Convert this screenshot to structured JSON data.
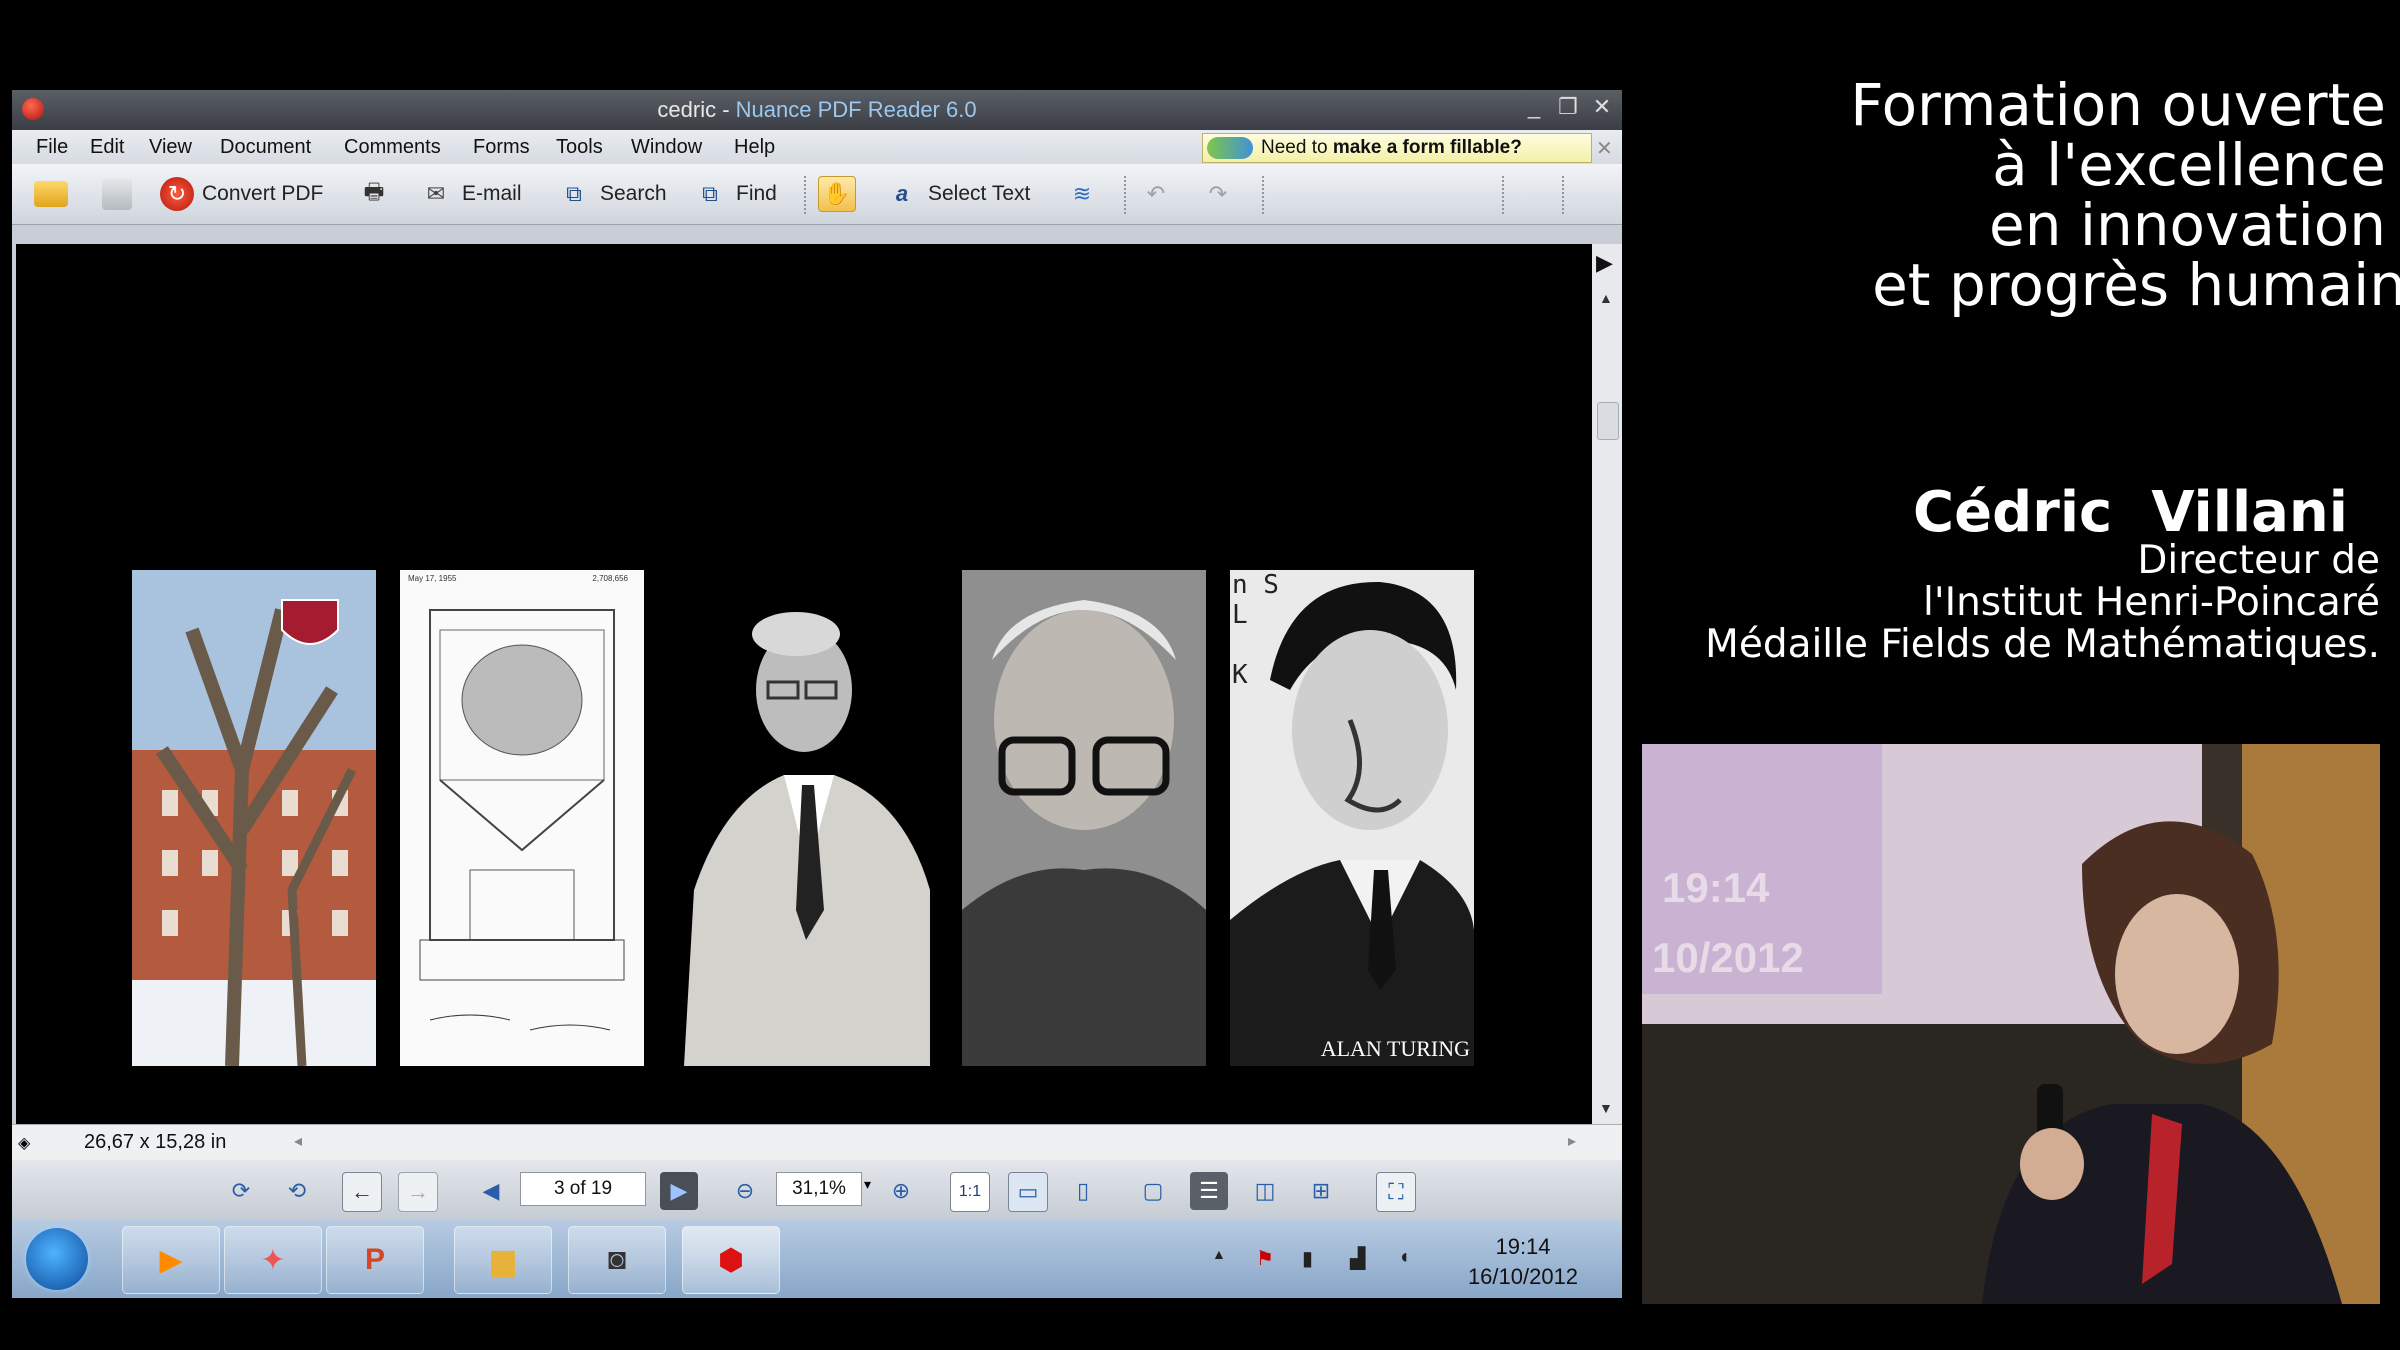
{
  "window": {
    "title_doc": "cedric",
    "title_sep": " - ",
    "title_app": "Nuance PDF Reader 6.0",
    "controls": [
      "_",
      "❐",
      "✕"
    ]
  },
  "menu": [
    "File",
    "Edit",
    "View",
    "Document",
    "Comments",
    "Forms",
    "Tools",
    "Window",
    "Help"
  ],
  "promo": {
    "prefix": "Need to ",
    "bold": "make a form fillable?",
    "close": "✕"
  },
  "toolbar": {
    "convert_label": "Convert PDF",
    "email_label": "E-mail",
    "search_label": "Search",
    "find_label": "Find",
    "select_text_label": "Select Text"
  },
  "document": {
    "turing_caption": "ALAN TURING",
    "patent_header": "May 17, 1955",
    "patent_number": "2,708,656",
    "stencil_letters": "n S\nL\n\nK"
  },
  "statusbar": {
    "page_size": "26,67 x 15,28 in"
  },
  "navbar": {
    "page_indicator": "3 of 19",
    "zoom": "31,1%",
    "actual_size": "1:1"
  },
  "taskbar": {
    "time": "19:14",
    "date": "16/10/2012"
  },
  "overlay": {
    "heading_lines": [
      "Formation ouverte",
      "à l'excellence",
      "en innovation",
      "et progrès humain"
    ],
    "speaker_name": "Cédric  Villani",
    "speaker_role_lines": [
      "Directeur de",
      "l'Institut Henri-Poincaré",
      "Médaille Fields de Mathématiques."
    ]
  },
  "video": {
    "screen_time": "19:14",
    "screen_date": "10/2012"
  },
  "colors": {
    "accent_title": "#9cc8f0",
    "doc_bg": "#000000",
    "taskbar": "#9db7d6"
  }
}
